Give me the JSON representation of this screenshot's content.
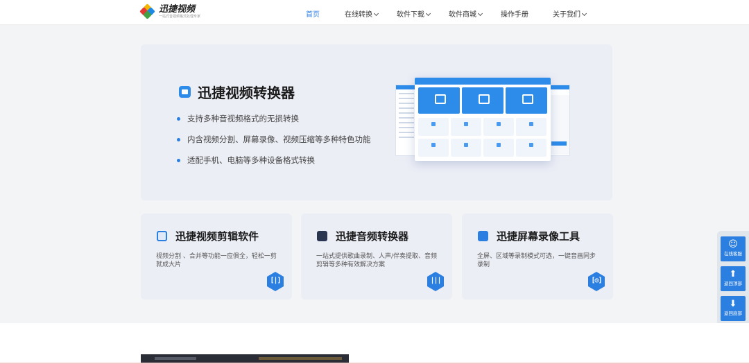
{
  "header": {
    "logo_text": "迅捷视频",
    "logo_slogan": "一站式音视频格式处理专家",
    "nav": [
      {
        "label": "首页",
        "active": true,
        "dropdown": false
      },
      {
        "label": "在线转换",
        "active": false,
        "dropdown": true
      },
      {
        "label": "软件下载",
        "active": false,
        "dropdown": true
      },
      {
        "label": "软件商城",
        "active": false,
        "dropdown": true
      },
      {
        "label": "操作手册",
        "active": false,
        "dropdown": false
      },
      {
        "label": "关于我们",
        "active": false,
        "dropdown": true
      }
    ]
  },
  "hero": {
    "title": "迅捷视频转换器",
    "features": [
      "支持多种音视频格式的无损转换",
      "内含视频分割、屏幕录像、视频压缩等多种特色功能",
      "适配手机、电脑等多种设备格式转换"
    ]
  },
  "cards": [
    {
      "title": "迅捷视频剪辑软件",
      "desc": "视频分割 、合并等功能一应俱全，轻松一剪就成大片",
      "icon": "video-edit-icon",
      "action_icon": "split-icon",
      "action_glyph": "[|]"
    },
    {
      "title": "迅捷音频转换器",
      "desc": "一站式提供歌曲录制、人声/伴奏提取、音频剪辑等多种有效解决方案",
      "icon": "audio-wave-icon",
      "action_icon": "waveform-icon",
      "action_glyph": "|||"
    },
    {
      "title": "迅捷屏幕录像工具",
      "desc": "全屏、区域等录制模式可选，一键音画同步录制",
      "icon": "screen-record-icon",
      "action_icon": "capture-frame-icon",
      "action_glyph": "[◎]"
    }
  ],
  "float_bar": [
    {
      "label": "在线客服",
      "icon": "chat-icon",
      "glyph": "☺"
    },
    {
      "label": "返回顶部",
      "icon": "arrow-up-icon",
      "glyph": "⬆"
    },
    {
      "label": "返回底部",
      "icon": "arrow-down-icon",
      "glyph": "⬇"
    }
  ],
  "colors": {
    "accent": "#2b7fe0",
    "page_bg": "#f3f4f6",
    "card_bg": "#eceef6"
  }
}
